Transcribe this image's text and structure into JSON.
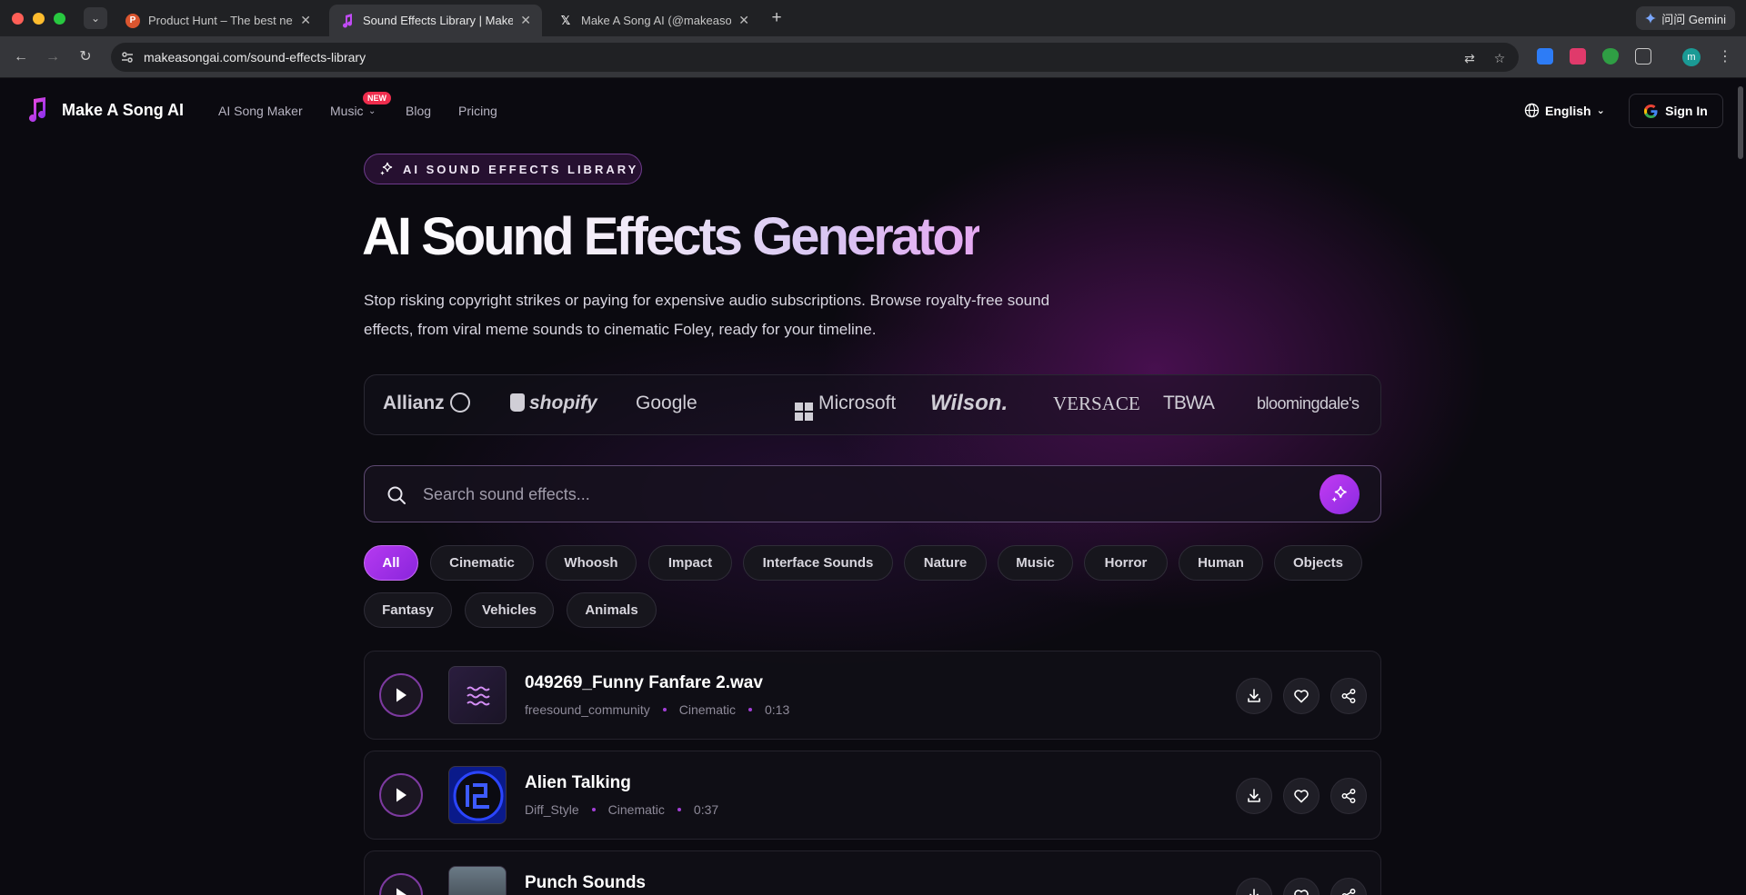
{
  "browser": {
    "tabs": [
      {
        "title": "Product Hunt – The best new",
        "favicon_letter": "P",
        "favicon_color": "#da552f"
      },
      {
        "title": "Sound Effects Library | Make",
        "favicon_color": "#b83ff2"
      },
      {
        "title": "Make A Song AI (@makeason",
        "favicon_letter": "𝕏"
      }
    ],
    "url": "makeasongai.com/sound-effects-library",
    "gemini_label": "问问 Gemini",
    "profile_initial": "m"
  },
  "site": {
    "brand": "Make A Song AI",
    "nav": [
      "AI Song Maker",
      "Music",
      "Blog",
      "Pricing"
    ],
    "new_badge": "NEW",
    "language": "English",
    "sign_in": "Sign In"
  },
  "hero": {
    "tag": "AI SOUND EFFECTS LIBRARY",
    "title": "AI Sound Effects Generator",
    "subtitle": "Stop risking copyright strikes or paying for expensive audio subscriptions. Browse royalty-free sound effects, from viral meme sounds to cinematic Foley, ready for your timeline."
  },
  "brands": [
    "Allianz",
    "shopify",
    "Google",
    "Microsoft",
    "Wilson.",
    "VERSACE",
    "TBWA",
    "bloomingdale's"
  ],
  "search": {
    "placeholder": "Search sound effects..."
  },
  "categories": [
    "All",
    "Cinematic",
    "Whoosh",
    "Impact",
    "Interface Sounds",
    "Nature",
    "Music",
    "Horror",
    "Human",
    "Objects",
    "Fantasy",
    "Vehicles",
    "Animals"
  ],
  "active_category": "All",
  "tracks": [
    {
      "title": "049269_Funny Fanfare 2.wav",
      "author": "freesound_community",
      "category": "Cinematic",
      "duration": "0:13"
    },
    {
      "title": "Alien Talking",
      "author": "Diff_Style",
      "category": "Cinematic",
      "duration": "0:37"
    },
    {
      "title": "Punch Sounds",
      "author": "",
      "category": "",
      "duration": ""
    }
  ],
  "colors": {
    "accent": "#b53af0",
    "background": "#0b0a10"
  }
}
